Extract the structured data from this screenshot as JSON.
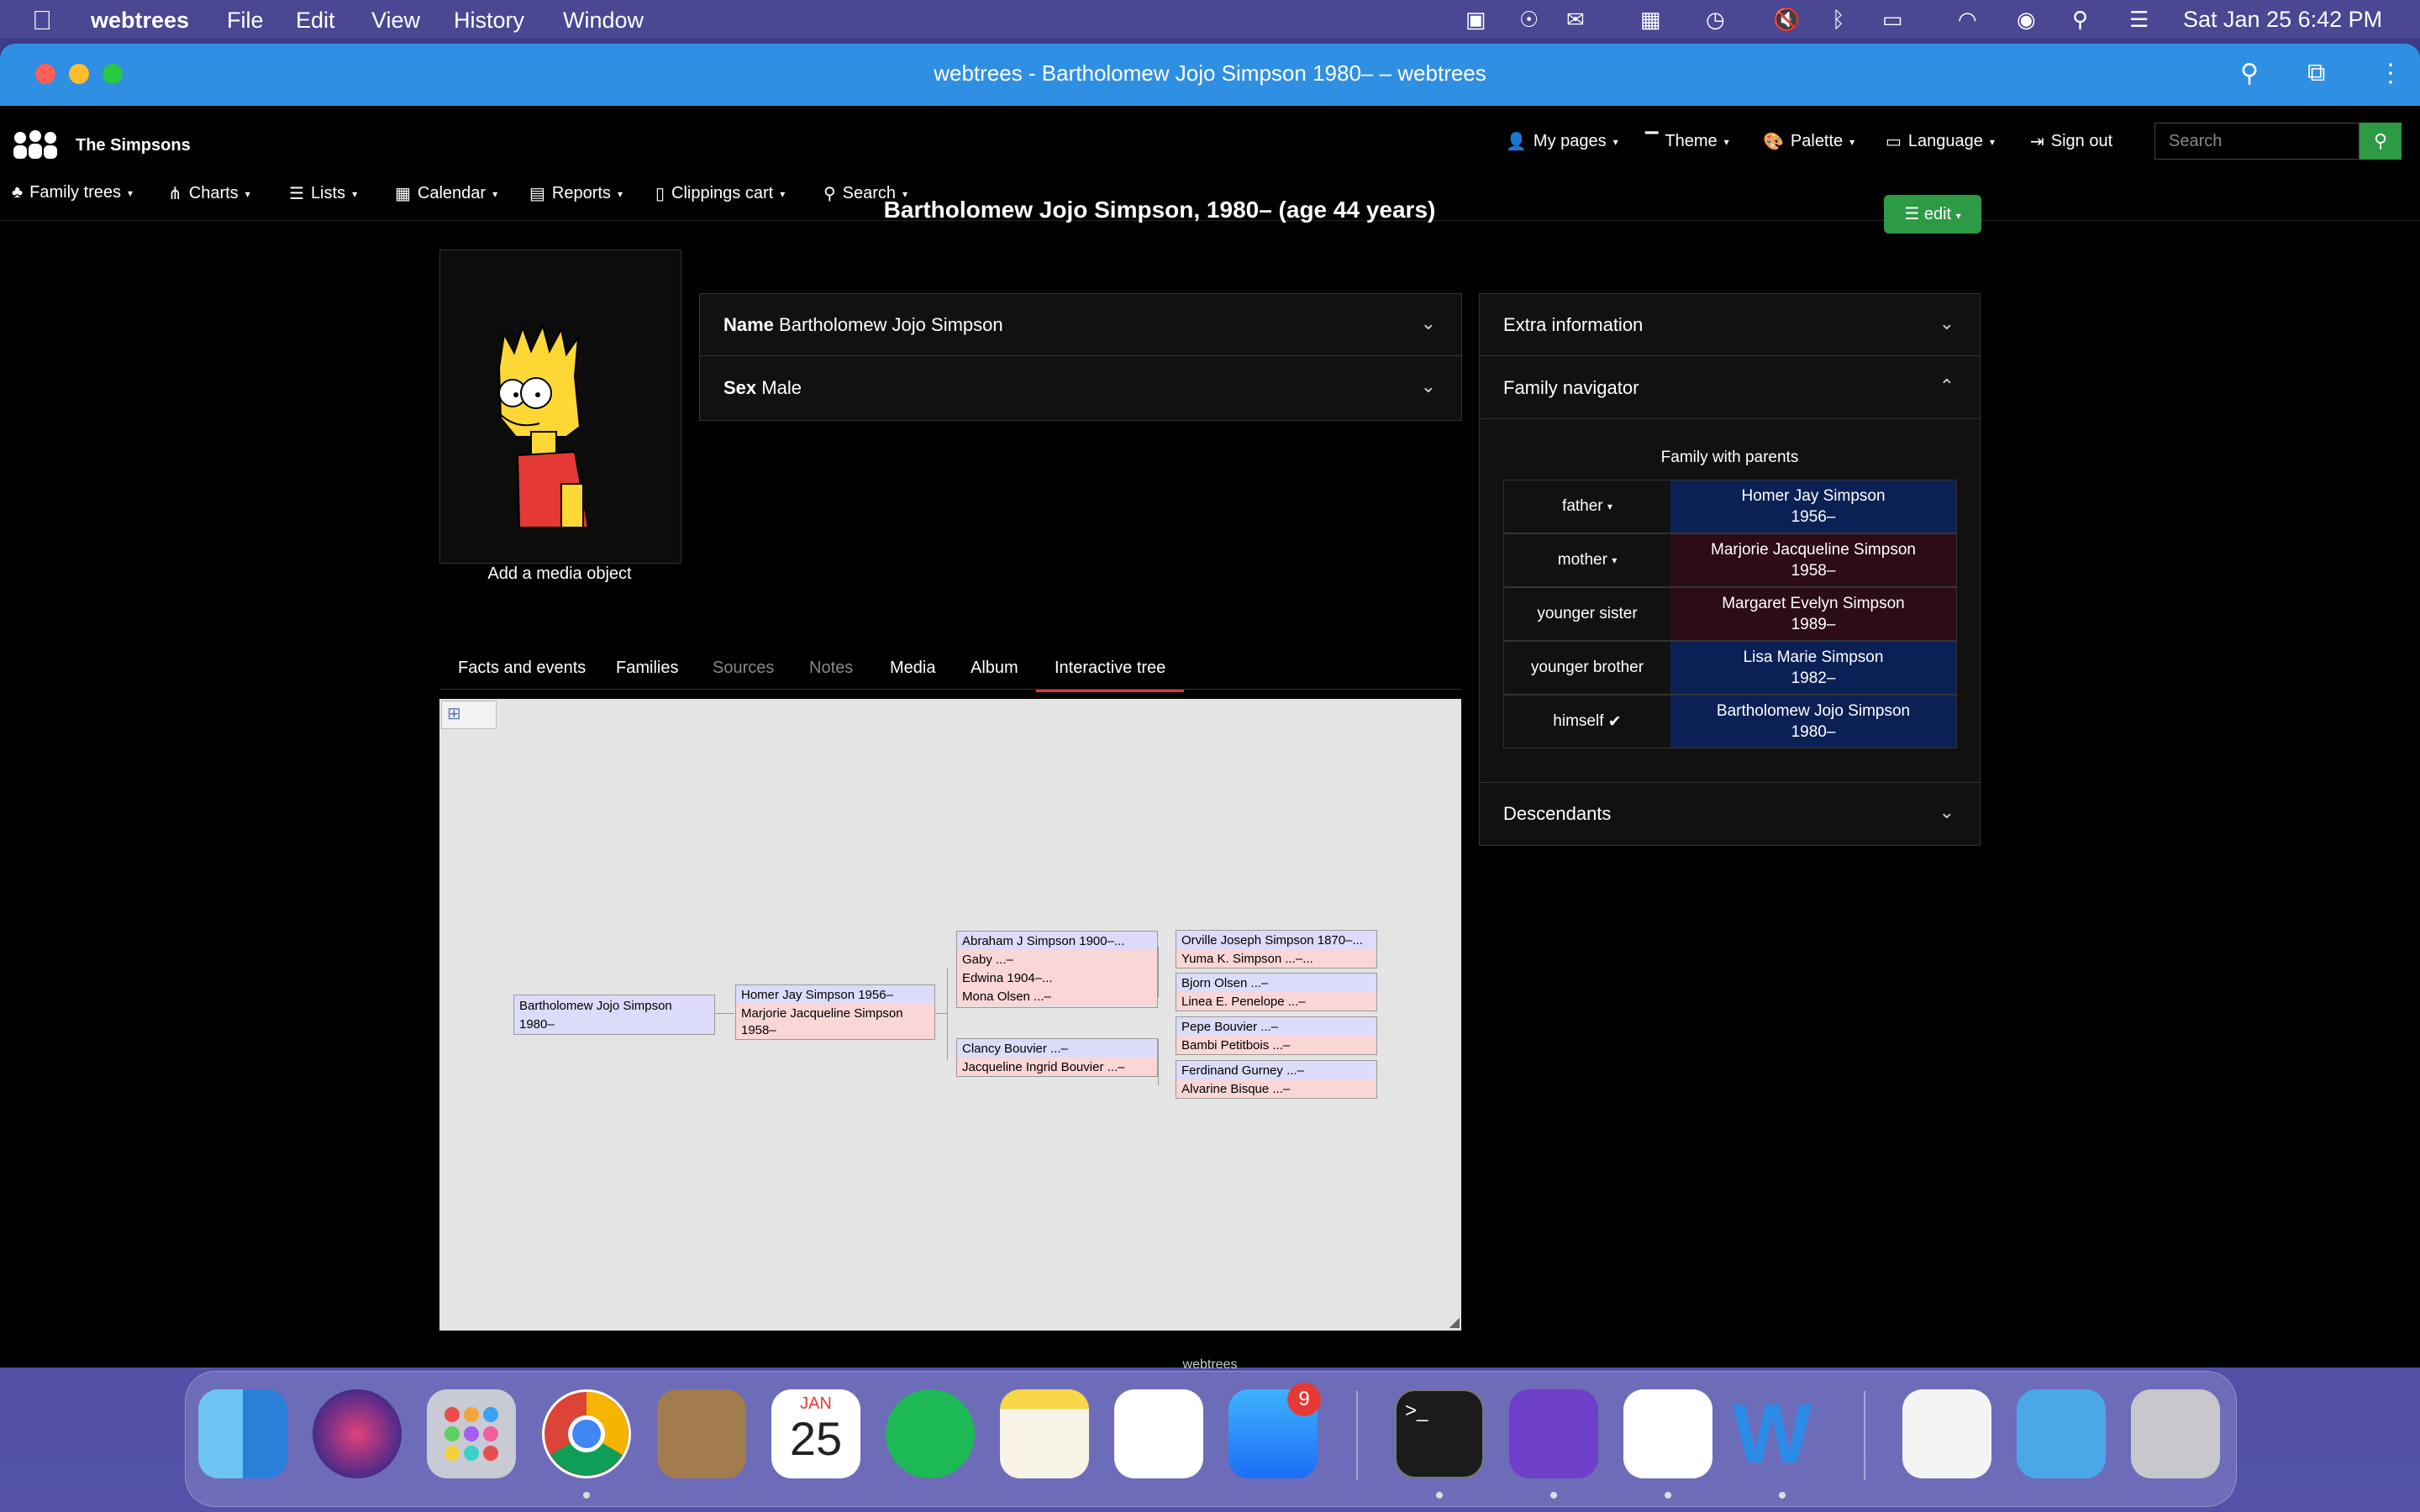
{
  "menubar": {
    "app": "webtrees",
    "items": [
      "File",
      "Edit",
      "View",
      "History",
      "Window"
    ],
    "clock": "Sat Jan 25  6:42 PM"
  },
  "window": {
    "title": "webtrees - Bartholomew Jojo Simpson 1980– – webtrees"
  },
  "header": {
    "site_name": "The Simpsons",
    "user_menu": [
      "My pages",
      "Theme",
      "Palette",
      "Language",
      "Sign out"
    ],
    "search_placeholder": "Search",
    "nav": [
      "Family trees",
      "Charts",
      "Lists",
      "Calendar",
      "Reports",
      "Clippings cart",
      "Search"
    ]
  },
  "page": {
    "title": "Bartholomew Jojo Simpson, 1980– (age 44 years)",
    "edit_label": "edit",
    "add_media": "Add a media object",
    "name_label": "Name",
    "name_value": "Bartholomew Jojo Simpson",
    "sex_label": "Sex",
    "sex_value": "Male",
    "tabs": [
      "Facts and events",
      "Families",
      "Sources",
      "Notes",
      "Media",
      "Album",
      "Interactive tree"
    ]
  },
  "sidebar": {
    "extra_info": "Extra information",
    "family_navigator": "Family navigator",
    "family_heading": "Family with parents",
    "members": [
      {
        "relation": "father",
        "name": "Homer Jay Simpson",
        "dates": "1956–",
        "sex": "male"
      },
      {
        "relation": "mother",
        "name": "Marjorie Jacqueline Simpson",
        "dates": "1958–",
        "sex": "female"
      },
      {
        "relation": "younger sister",
        "name": "Margaret Evelyn Simpson",
        "dates": "1989–",
        "sex": "female"
      },
      {
        "relation": "younger brother",
        "name": "Lisa Marie Simpson",
        "dates": "1982–",
        "sex": "male"
      },
      {
        "relation": "himself",
        "name": "Bartholomew Jojo Simpson",
        "dates": "1980–",
        "sex": "male"
      }
    ],
    "descendants": "Descendants"
  },
  "tree": {
    "root": [
      "Bartholomew Jojo Simpson",
      "1980–"
    ],
    "parents": [
      "Homer Jay Simpson 1956–",
      "Marjorie Jacqueline Simpson",
      "1958–"
    ],
    "gp1": [
      "Abraham J Simpson 1900–...",
      "Gaby ...–",
      "Edwina 1904–...",
      "Mona Olsen ...–"
    ],
    "gp2": [
      "Clancy Bouvier ...–",
      "Jacqueline Ingrid Bouvier ...–"
    ],
    "ggp1": [
      "Orville Joseph Simpson 1870–...",
      "Yuma K. Simpson ...–..."
    ],
    "ggp2": [
      "Bjorn Olsen ...–",
      "Linea E. Penelope ...–"
    ],
    "ggp3": [
      "Pepe Bouvier ...–",
      "Bambi Petitbois ...–"
    ],
    "ggp4": [
      "Ferdinand Gurney ...–",
      "Alvarine Bisque ...–"
    ]
  },
  "dock": {
    "calendar_month": "JAN",
    "calendar_day": "25",
    "appstore_badge": "9",
    "below_label": "webtrees"
  }
}
